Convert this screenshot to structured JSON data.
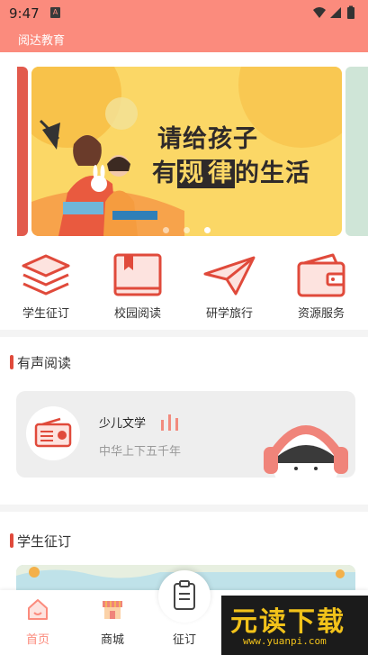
{
  "status_bar": {
    "time": "9:47",
    "notif_badge": "A",
    "icons": [
      "wifi-icon",
      "signal-icon",
      "battery-icon"
    ]
  },
  "app_bar": {
    "title": "阅达教育"
  },
  "banner": {
    "line1": "请给孩子",
    "line2_before": "有",
    "line2_hl1": "规",
    "line2_hl2": "律",
    "line2_after": "的生活",
    "page_count": 3,
    "active_index": 2
  },
  "quick_menu": {
    "items": [
      {
        "label": "学生征订",
        "icon": "stack-books-icon"
      },
      {
        "label": "校园阅读",
        "icon": "book-bookmark-icon"
      },
      {
        "label": "研学旅行",
        "icon": "paper-plane-icon"
      },
      {
        "label": "资源服务",
        "icon": "wallet-icon"
      }
    ]
  },
  "audio_section": {
    "title": "有声阅读",
    "card": {
      "title": "少儿文学",
      "subtitle": "中华上下五千年",
      "icon": "radio-icon"
    }
  },
  "student_section": {
    "title": "学生征订"
  },
  "bottom_nav": {
    "items": [
      {
        "label": "首页",
        "icon": "home-icon",
        "active": true
      },
      {
        "label": "商城",
        "icon": "shop-icon",
        "active": false
      },
      {
        "label": "征订",
        "icon": "clipboard-icon",
        "active": false
      }
    ]
  },
  "watermark": {
    "text": "元读下载",
    "url": "www.yuanpi.com"
  },
  "colors": {
    "primary": "#fb8b7d",
    "accent_red": "#e04a3b",
    "banner_yellow": "#fbd766"
  }
}
